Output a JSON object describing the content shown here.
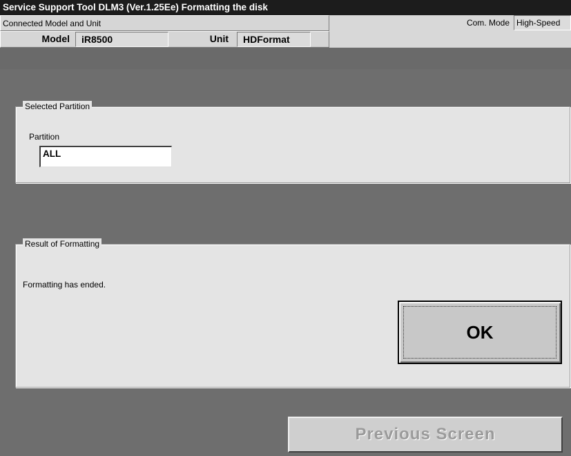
{
  "window": {
    "title": "Service Support Tool DLM3 (Ver.1.25Ee) Formatting the disk"
  },
  "header": {
    "connected_label": "Connected Model and Unit",
    "com_mode_label": "Com. Mode",
    "com_mode_value": "High-Speed",
    "model_label": "Model",
    "model_value": "iR8500",
    "unit_label": "Unit",
    "unit_value": "HDFormat"
  },
  "selected_partition": {
    "group_label": "Selected Partition",
    "partition_label": "Partition",
    "partition_value": "ALL"
  },
  "result": {
    "group_label": "Result of Formatting",
    "message": "Formatting has ended.",
    "ok_label": "OK"
  },
  "footer": {
    "previous_label": "Previous Screen"
  }
}
